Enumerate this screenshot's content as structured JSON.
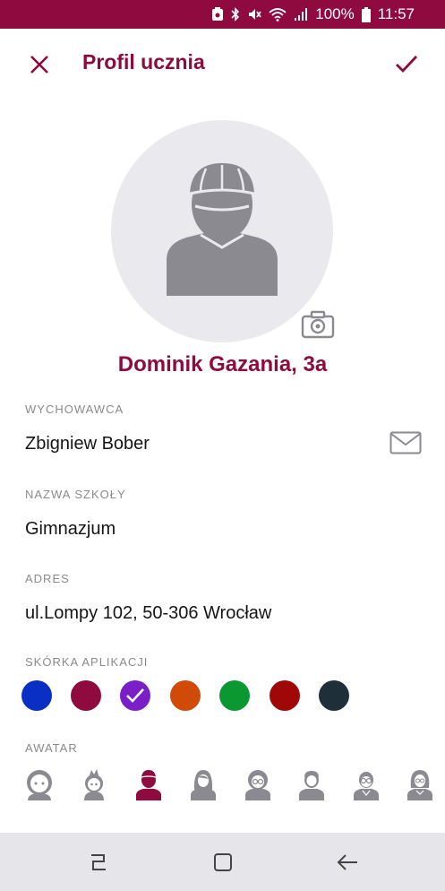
{
  "status": {
    "battery": "100%",
    "time": "11:57"
  },
  "appbar": {
    "title": "Profil ucznia"
  },
  "profile": {
    "name": "Dominik Gazania, 3a"
  },
  "fields": {
    "teacher_label": "WYCHOWAWCA",
    "teacher_value": "Zbigniew Bober",
    "school_label": "NAZWA SZKOŁY",
    "school_value": "Gimnazjum",
    "address_label": "ADRES",
    "address_value": "ul.Lompy 102, 50-306 Wrocław",
    "skin_label": "SKÓRKA APLIKACJI",
    "avatar_label": "AWATAR"
  },
  "skin_colors": [
    "#0a2fc4",
    "#8e0a3f",
    "#7a1fc8",
    "#d04a08",
    "#0b9830",
    "#a00808",
    "#1f2f3a"
  ],
  "selected_skin": 2,
  "selected_avatar": 2,
  "colors": {
    "accent": "#8e0a3f",
    "icon_gray": "#8a8a90",
    "circle_bg": "#eaeaee"
  }
}
